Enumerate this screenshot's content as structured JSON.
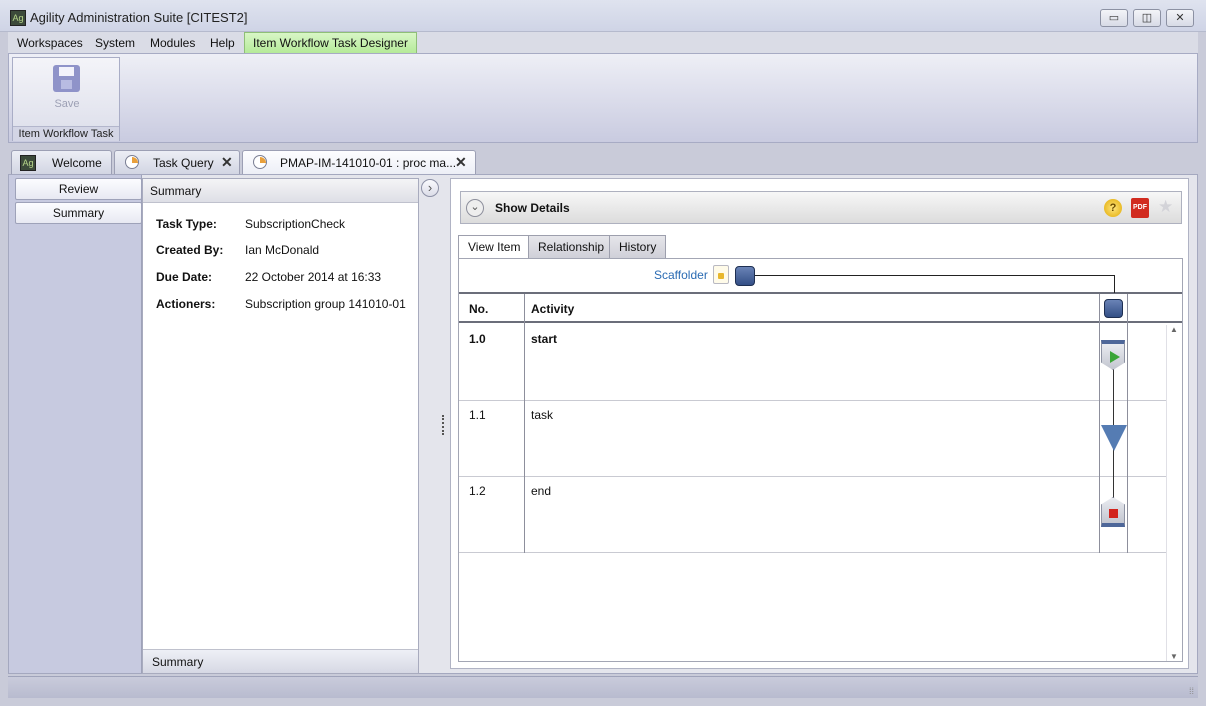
{
  "window": {
    "title": "Agility Administration Suite [CITEST2]",
    "app_icon_text": "Ag",
    "minimize": "▭",
    "maximize": "◫",
    "close": "✕"
  },
  "menubar": {
    "items": [
      "Workspaces",
      "System",
      "Modules",
      "Help"
    ],
    "active": "Item Workflow Task Designer"
  },
  "ribbon": {
    "save_label": "Save",
    "group_label": "Item Workflow Task"
  },
  "doc_tabs": [
    {
      "label": "Welcome"
    },
    {
      "label": "Task Query",
      "close": "✕"
    },
    {
      "label": "PMAP-IM-141010-01 : proc ma...",
      "close": "✕"
    }
  ],
  "left_nav": {
    "items": [
      "Review",
      "Summary"
    ]
  },
  "summary": {
    "header": "Summary",
    "footer": "Summary",
    "fields": [
      {
        "label": "Task Type:",
        "value": "SubscriptionCheck"
      },
      {
        "label": "Created By:",
        "value": "Ian McDonald"
      },
      {
        "label": "Due Date:",
        "value": "22 October 2014 at 16:33"
      },
      {
        "label": "Actioners:",
        "value": "Subscription group 141010-01"
      }
    ]
  },
  "details": {
    "label": "Show Details",
    "help_icon": "?",
    "pdf_icon": "PDF",
    "star_icon": "★"
  },
  "item_tabs": [
    "View Item",
    "Relationship",
    "History"
  ],
  "workflow": {
    "scaffolder": "Scaffolder",
    "columns": {
      "no": "No.",
      "activity": "Activity"
    },
    "rows": [
      {
        "no": "1.0",
        "activity": "start"
      },
      {
        "no": "1.1",
        "activity": "task"
      },
      {
        "no": "1.2",
        "activity": "end"
      }
    ]
  },
  "icons": {
    "save": "save-icon",
    "lock": "lock-icon",
    "start": "play-icon",
    "task": "task-triangle-icon",
    "end": "stop-icon"
  },
  "colors": {
    "active_menu": "#b5ea99",
    "link": "#2a6bb3",
    "play": "#3aa537",
    "stop": "#d2231c",
    "node": "#557cb3"
  }
}
